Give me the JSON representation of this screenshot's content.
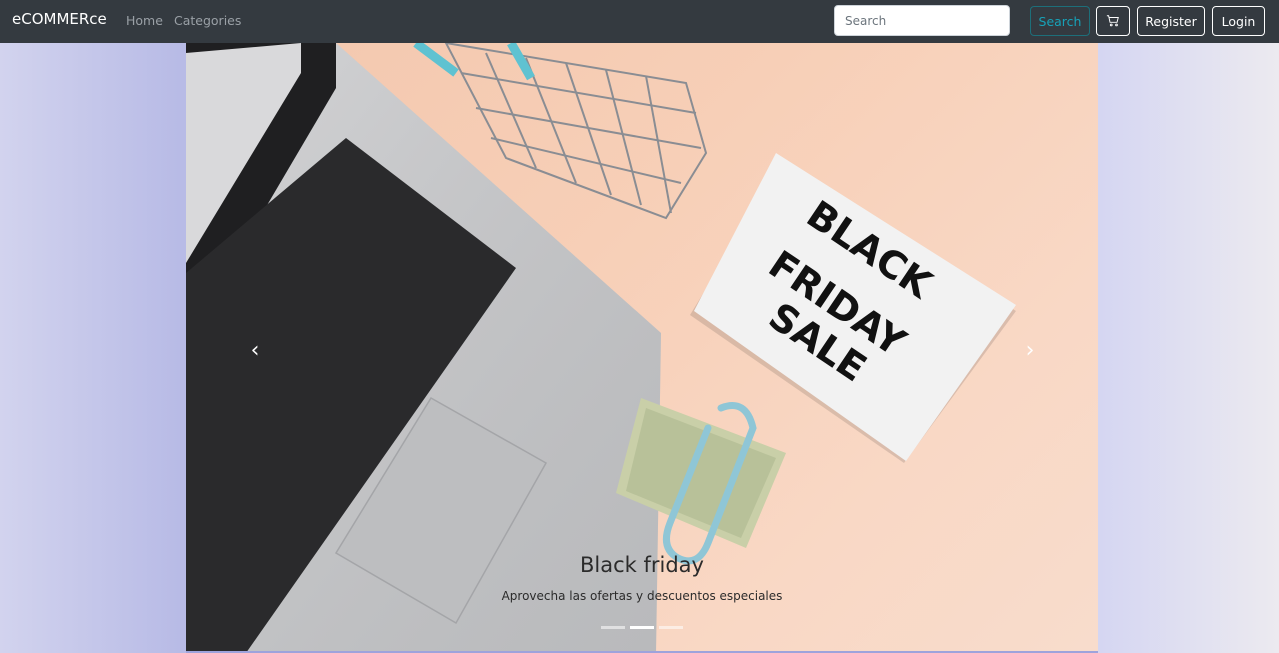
{
  "navbar": {
    "brand": "eCOMMERce",
    "links": [
      "Home",
      "Categories"
    ],
    "search_placeholder": "Search",
    "search_button": "Search",
    "register_button": "Register",
    "login_button": "Login",
    "cart_icon": "cart-icon"
  },
  "carousel": {
    "active_index": 1,
    "slide_count": 3,
    "caption_title": "Black friday",
    "caption_text": "Aprovecha las ofertas y descuentos especiales",
    "lightbox_text": [
      "BLACK",
      "FRIDAY",
      "SALE"
    ],
    "prev_icon": "chevron-left-icon",
    "next_icon": "chevron-right-icon"
  },
  "colors": {
    "navbar_bg": "#343a40",
    "search_accent": "#17a2b8"
  }
}
